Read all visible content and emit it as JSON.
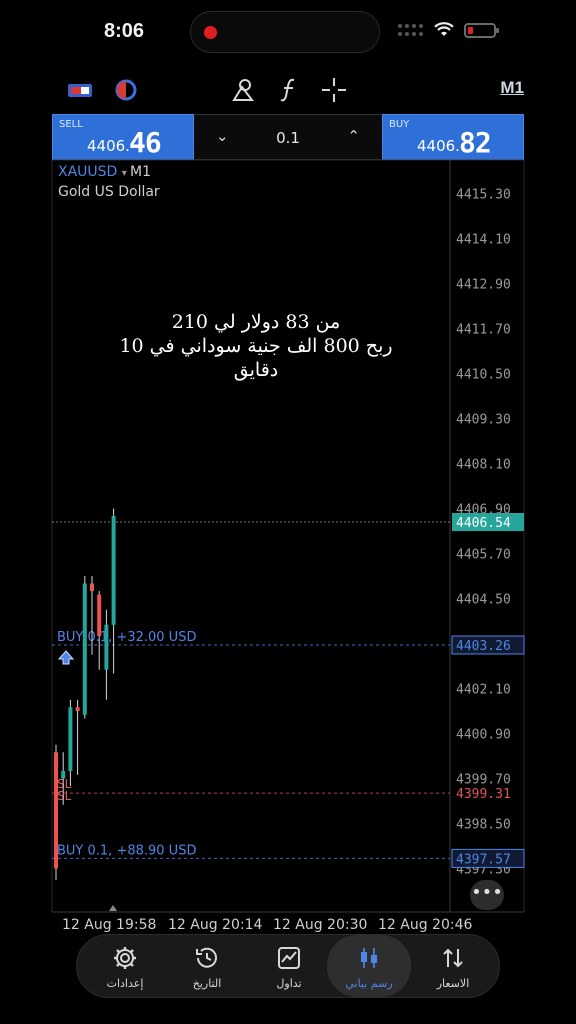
{
  "status_bar": {
    "time": "8:06"
  },
  "toolbar": {
    "timeframe": "M1",
    "icons": [
      "account-switch-icon",
      "indicator-icon",
      "objects-icon",
      "function-icon",
      "crosshair-icon"
    ]
  },
  "trade_panel": {
    "sell": {
      "label": "SELL",
      "price_prefix": "4406.",
      "price_big": "46"
    },
    "buy": {
      "label": "BUY",
      "price_prefix": "4406.",
      "price_big": "82"
    },
    "lot": "0.1"
  },
  "chart": {
    "symbol": "XAUUSD",
    "timeframe": "M1",
    "description": "Gold US Dollar",
    "price_labels": [
      "4415.30",
      "4414.10",
      "4412.90",
      "4411.70",
      "4410.50",
      "4409.30",
      "4408.10",
      "4406.90",
      "4405.70",
      "4404.50",
      "4402.10",
      "4400.90",
      "4399.70",
      "4398.50",
      "4397.30"
    ],
    "current_price": "4406.54",
    "position_price_1": "4403.26",
    "sl_price": "4399.31",
    "position_price_2": "4397.57",
    "trade_lines": [
      "BUY 0.1, +32.00 USD",
      "BUY 0.1, +88.90 USD"
    ],
    "sl_labels": [
      "SL",
      "SL"
    ],
    "time_labels": [
      "12 Aug 19:58",
      "12 Aug 20:14",
      "12 Aug 20:30",
      "12 Aug 20:46"
    ],
    "colors": {
      "bull": "#26a69a",
      "bear": "#ef5350",
      "buy_line": "#4f85e6",
      "sl_line": "#e05555",
      "axis": "#9a9a9a"
    }
  },
  "chart_data": {
    "type": "candlestick",
    "title": "",
    "xlabel": "",
    "ylabel": "",
    "ylim": [
      4397.0,
      4416.0
    ],
    "candles": [
      {
        "open": 4400.4,
        "high": 4400.6,
        "low": 4397.0,
        "close": 4397.3
      },
      {
        "open": 4399.7,
        "high": 4400.4,
        "low": 4399.0,
        "close": 4399.9
      },
      {
        "open": 4399.9,
        "high": 4401.8,
        "low": 4399.5,
        "close": 4401.6
      },
      {
        "open": 4401.6,
        "high": 4401.8,
        "low": 4399.8,
        "close": 4401.5
      },
      {
        "open": 4401.4,
        "high": 4405.1,
        "low": 4401.3,
        "close": 4404.9
      },
      {
        "open": 4404.9,
        "high": 4405.1,
        "low": 4403.0,
        "close": 4404.7
      },
      {
        "open": 4404.6,
        "high": 4404.7,
        "low": 4402.6,
        "close": 4403.5
      },
      {
        "open": 4402.6,
        "high": 4404.2,
        "low": 4401.8,
        "close": 4403.8
      },
      {
        "open": 4403.8,
        "high": 4406.9,
        "low": 4402.5,
        "close": 4406.7
      }
    ]
  },
  "overlay_text": {
    "line1": "من 83 دولار لي 210",
    "line2": "ربح 800 الف جنية سوداني في 10 دقايق"
  },
  "bottom_nav": [
    {
      "label": "إعدادات",
      "icon": "gear-icon"
    },
    {
      "label": "التاريخ",
      "icon": "history-icon"
    },
    {
      "label": "تداول",
      "icon": "trade-chart-icon"
    },
    {
      "label": "رسم بياني",
      "icon": "candles-icon",
      "active": true
    },
    {
      "label": "الاسعار",
      "icon": "quotes-icon"
    }
  ],
  "more_button": "•••"
}
